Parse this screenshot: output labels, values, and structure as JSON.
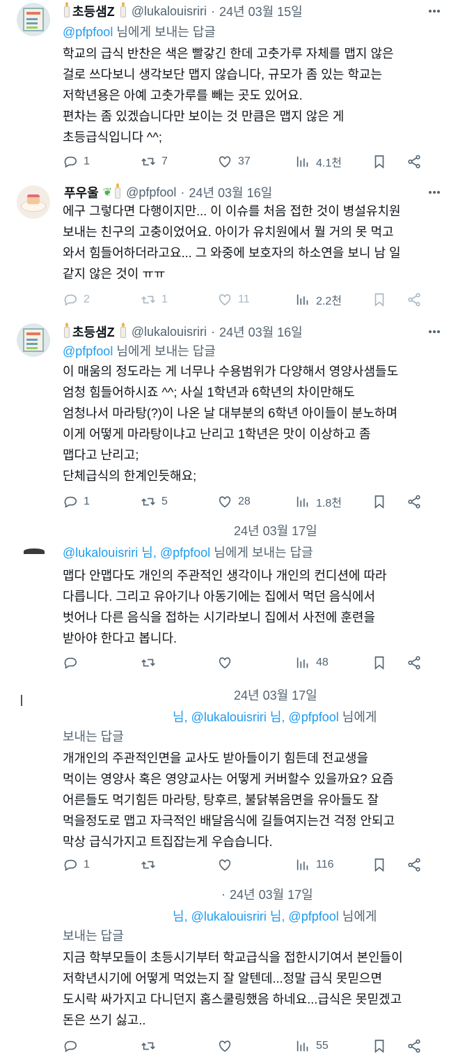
{
  "tweets": [
    {
      "name": "초등샘Z",
      "handle": "@lukalouisriri",
      "date": "24년 03월 15일",
      "reply_mentions": "@pfpfool",
      "reply_suffix": "님에게 보내는 답글",
      "lines": [
        "학교의 급식 반찬은 색은 빨갛긴 한데 고춧가루 자체를 맵지 않은",
        "걸로 쓰다보니 생각보단 맵지 않습니다, 규모가 좀 있는 학교는",
        "저학년용은 아예 고춧가루를 빼는 곳도 있어요.",
        "편차는 좀 있겠습니다만 보이는 것 만큼은 맵지 않은 게",
        "초등급식입니다 ^^;"
      ],
      "replies": "1",
      "retweets": "7",
      "likes": "37",
      "views": "4.1천"
    },
    {
      "name": "푸우울",
      "handle": "@pfpfool",
      "date": "24년 03월 16일",
      "lines": [
        "에구 그렇다면 다행이지만... 이 이슈를 처음 접한 것이 병설유치원",
        "보내는 친구의 고충이었어요. 아이가 유치원에서 뭘 거의 못 먹고",
        "와서 힘들어하더라고요... 그 와중에 보호자의 하소연을 보니 남 일",
        "같지 않은 것이 ㅠㅠ"
      ],
      "replies": "2",
      "retweets": "1",
      "likes": "11",
      "views": "2.2천"
    },
    {
      "name": "초등샘Z",
      "handle": "@lukalouisriri",
      "date": "24년 03월 16일",
      "reply_mentions": "@pfpfool",
      "reply_suffix": "님에게 보내는 답글",
      "lines": [
        "이 매움의 정도라는 게 너무나 수용범위가 다양해서 영양사샘들도",
        "엄청 힘들어하시죠 ^^; 사실 1학년과 6학년의 차이만해도",
        "엄청나서 마라탕(?)이 나온 날 대부분의 6학년 아이들이 분노하며",
        "이게 어떻게 마라탕이냐고 난리고 1학년은 맛이 이상하고 좀",
        "맵다고 난리고;",
        "단체급식의 한계인듯해요;"
      ],
      "replies": "1",
      "retweets": "5",
      "likes": "28",
      "views": "1.8천"
    },
    {
      "date": "24년 03월 17일",
      "reply_mentions": "@lukalouisriri 님, @pfpfool",
      "reply_suffix": "님에게 보내는 답글",
      "lines": [
        "맵다 안맵다도 개인의 주관적인 생각이나 개인의 컨디션에 따라",
        "다릅니다. 그리고 유아기나 아동기에는 집에서 먹던 음식에서",
        "벗어나 다른 음식을 접하는 시기라보니 집에서 사전에 훈련을",
        "받아야 한다고 봅니다."
      ],
      "replies": "",
      "retweets": "",
      "likes": "",
      "views": "48"
    },
    {
      "date": "24년 03월 17일",
      "reply_mentions": "님, @lukalouisriri 님, @pfpfool",
      "reply_suffix": "님에게",
      "reply_cont": "보내는 답글",
      "lines": [
        "개개인의 주관적인면을 교사도 받아들이기 힘든데 전교생을",
        "먹이는 영양사 혹은 영양교사는 어떻게 커버할수 있을까요? 요즘",
        "어른들도 먹기힘든 마라탕, 탕후르, 불닭볶음면을 유아들도 잘",
        "먹을정도로 맵고 자극적인 배달음식에 길들여지는건 걱정 안되고",
        "막상 급식가지고 트집잡는게 우습습니다."
      ],
      "replies": "1",
      "retweets": "",
      "likes": "",
      "views": "116"
    },
    {
      "date": "24년 03월 17일",
      "reply_mentions": "님, @lukalouisriri 님, @pfpfool",
      "reply_suffix": "님에게",
      "reply_cont": "보내는 답글",
      "lines": [
        "지금 학부모들이 초등시기부터 학교급식을 접한시기여서 본인들이",
        "저학년시기에 어떻게 먹었는지 잘 알텐데...정말 급식 못믿으면",
        "도시락 싸가지고 다니던지 홈스쿨링했음 하네요...급식은 못믿겠고",
        "돈은 쓰기 싫고.."
      ],
      "replies": "",
      "retweets": "",
      "likes": "",
      "views": "55"
    }
  ],
  "icons": {
    "reply": "reply-icon",
    "retweet": "retweet-icon",
    "like": "heart-icon",
    "views": "views-icon",
    "bookmark": "bookmark-icon",
    "share": "share-icon",
    "more": "more-icon"
  }
}
